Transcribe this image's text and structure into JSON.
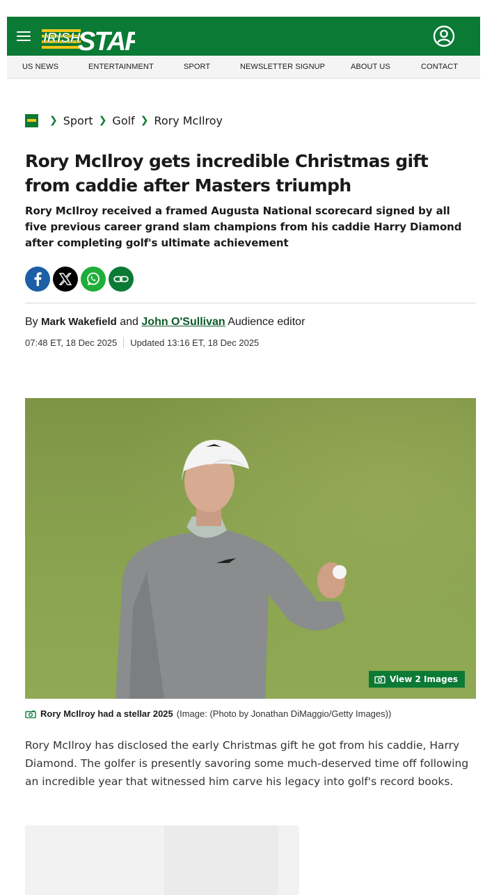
{
  "brand": {
    "name_part1": "IRISH",
    "name_part2": "STAR",
    "colors": {
      "primary": "#0b7a35",
      "accent": "#f5c518"
    }
  },
  "header": {
    "menu_icon": "hamburger-icon",
    "account_icon": "user-circle-icon"
  },
  "nav": {
    "items": [
      "US NEWS",
      "ENTERTAINMENT",
      "SPORT",
      "NEWSLETTER SIGNUP",
      "ABOUT US",
      "CONTACT"
    ]
  },
  "breadcrumb": {
    "items": [
      "Sport",
      "Golf",
      "Rory McIlroy"
    ]
  },
  "article": {
    "title": "Rory McIlroy gets incredible Christmas gift from caddie after Masters triumph",
    "standfirst": "Rory McIlroy received a framed Augusta National scorecard signed by all five previous career grand slam champions from his caddie Harry Diamond after completing golf's ultimate achievement",
    "share": [
      "facebook-icon",
      "x-icon",
      "whatsapp-icon",
      "link-icon"
    ],
    "byline": {
      "prefix": "By",
      "author1": "Mark Wakefield",
      "joiner": "and",
      "author2": "John O'Sullivan",
      "author2_role": "Audience editor"
    },
    "published": "07:48 ET, 18 Dec 2025",
    "updated": "Updated 13:16 ET, 18 Dec 2025",
    "image": {
      "view_label": "View 2 Images",
      "caption": "Rory McIlroy had a stellar 2025",
      "credit": "(Image: (Photo by Jonathan DiMaggio/Getty Images))"
    },
    "body": "Rory McIlroy has disclosed the early Christmas gift he got from his caddie, Harry Diamond. The golfer is presently savoring some much-deserved time off following an incredible year that witnessed him carve his legacy into golf's record books."
  }
}
